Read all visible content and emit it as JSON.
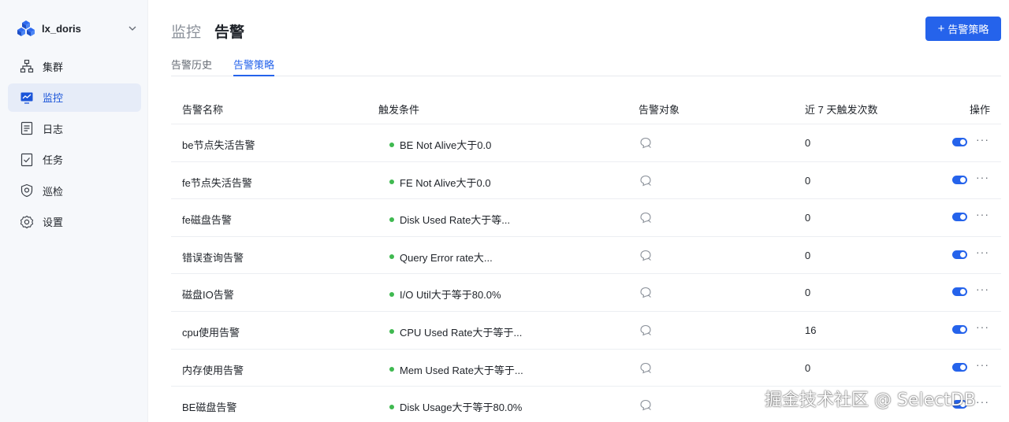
{
  "sidebar": {
    "cluster_name": "lx_doris",
    "items": [
      {
        "label": "集群",
        "icon": "cluster-icon",
        "active": false
      },
      {
        "label": "监控",
        "icon": "monitor-icon",
        "active": true
      },
      {
        "label": "日志",
        "icon": "log-icon",
        "active": false
      },
      {
        "label": "任务",
        "icon": "task-icon",
        "active": false
      },
      {
        "label": "巡检",
        "icon": "inspection-icon",
        "active": false
      },
      {
        "label": "设置",
        "icon": "gear-icon",
        "active": false
      }
    ]
  },
  "header": {
    "parent": "监控",
    "current": "告警",
    "create_button": "告警策略"
  },
  "tabs": [
    {
      "label": "告警历史",
      "active": false
    },
    {
      "label": "告警策略",
      "active": true
    }
  ],
  "table": {
    "columns": [
      "告警名称",
      "触发条件",
      "告警对象",
      "近 7 天触发次数",
      "操作"
    ],
    "rows": [
      {
        "name": "be节点失活告警",
        "condition": "BE Not Alive大于0.0",
        "count": "0",
        "enabled": true
      },
      {
        "name": "fe节点失活告警",
        "condition": "FE Not Alive大于0.0",
        "count": "0",
        "enabled": true
      },
      {
        "name": "fe磁盘告警",
        "condition": "Disk Used Rate大于等...",
        "count": "0",
        "enabled": true
      },
      {
        "name": "错误查询告警",
        "condition": "Query Error rate大...",
        "count": "0",
        "enabled": true
      },
      {
        "name": "磁盘IO告警",
        "condition": "I/O Util大于等于80.0%",
        "count": "0",
        "enabled": true
      },
      {
        "name": "cpu使用告警",
        "condition": "CPU Used Rate大于等于...",
        "count": "16",
        "enabled": true
      },
      {
        "name": "内存使用告警",
        "condition": "Mem Used Rate大于等于...",
        "count": "0",
        "enabled": true
      },
      {
        "name": "BE磁盘告警",
        "condition": "Disk Usage大于等于80.0%",
        "count": "",
        "enabled": true
      }
    ]
  },
  "colors": {
    "primary": "#2563eb",
    "status_dot": "#3fb950",
    "sidebar_bg": "#f6f8fb",
    "active_nav_bg": "#e6ecf8"
  },
  "watermark": "掘金技术社区 @ SelectDB"
}
